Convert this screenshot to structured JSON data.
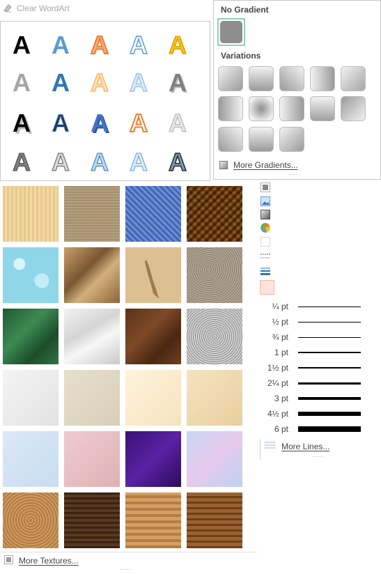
{
  "clear_wordart": {
    "label": "Clear WordArt"
  },
  "wordart": {
    "styles": [
      {
        "glyph": "A"
      },
      {
        "glyph": "A"
      },
      {
        "glyph": "A"
      },
      {
        "glyph": "A"
      },
      {
        "glyph": "A"
      },
      {
        "glyph": "A"
      },
      {
        "glyph": "A"
      },
      {
        "glyph": "A"
      },
      {
        "glyph": "A"
      },
      {
        "glyph": "A"
      },
      {
        "glyph": "A"
      },
      {
        "glyph": "A"
      },
      {
        "glyph": "A"
      },
      {
        "glyph": "A"
      },
      {
        "glyph": "A"
      },
      {
        "glyph": "A"
      },
      {
        "glyph": "A"
      },
      {
        "glyph": "A"
      },
      {
        "glyph": "A"
      },
      {
        "glyph": "A"
      }
    ]
  },
  "gradient_panel": {
    "no_gradient_title": "No Gradient",
    "variations_title": "Variations",
    "more_gradients": "More Gradients..."
  },
  "textures": {
    "more_textures": "More Textures..."
  },
  "line_weights": {
    "items": [
      "¼ pt",
      "½ pt",
      "¾ pt",
      "1 pt",
      "1½ pt",
      "2¼ pt",
      "3 pt",
      "4½ pt",
      "6 pt"
    ],
    "more_lines": "More Lines..."
  },
  "colors": {
    "accent_selected": "#8fd3b9",
    "gradient_gray": "#8e8e8e"
  }
}
